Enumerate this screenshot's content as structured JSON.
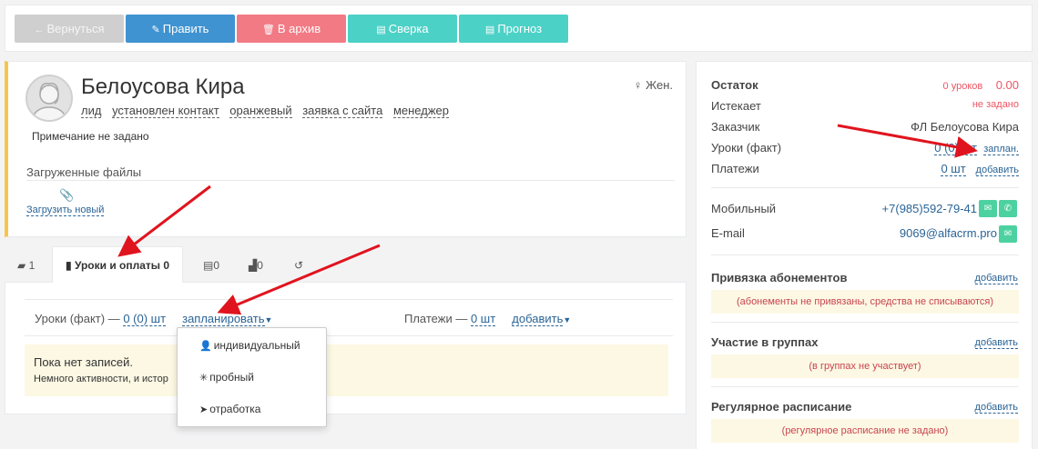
{
  "toolbar": {
    "back": "Вернуться",
    "edit": "Править",
    "archive": "В архив",
    "reconcile": "Сверка",
    "forecast": "Прогноз"
  },
  "profile": {
    "name": "Белоусова Кира",
    "gender": "Жен.",
    "tags": [
      "лид",
      "установлен контакт",
      "оранжевый",
      "заявка с сайта",
      "менеджер"
    ],
    "note": "Примечание не задано",
    "files_title": "Загруженные файлы",
    "upload": "Загрузить новый"
  },
  "tabs": [
    {
      "label": "1",
      "icon": "comments-icon"
    },
    {
      "label": "Уроки и оплаты 0",
      "icon": "book-icon",
      "active": true
    },
    {
      "label": "0",
      "icon": "clipboard-icon"
    },
    {
      "label": "0",
      "icon": "chart-icon"
    },
    {
      "label": "",
      "icon": "history-icon"
    }
  ],
  "lessons": {
    "label": "Уроки (факт) —",
    "count": "0 (0) шт",
    "plan": "запланировать",
    "payments_label": "Платежи —",
    "payments_count": "0 шт",
    "add": "добавить",
    "empty_title": "Пока нет записей.",
    "empty_text": "Немного активности, и истор"
  },
  "dropdown": {
    "items": [
      "индивидуальный",
      "пробный",
      "отработка"
    ]
  },
  "right": {
    "balance_label": "Остаток",
    "balance_lessons": "0 уроков",
    "balance_amount": "0.00",
    "expires_label": "Истекает",
    "expires_value": "не задано",
    "customer_label": "Заказчик",
    "customer_value": "ФЛ Белоусова Кира",
    "lessons_label": "Уроки (факт)",
    "lessons_value": "0 (0) шт",
    "lessons_plan": "заплан.",
    "payments_label": "Платежи",
    "payments_value": "0 шт",
    "payments_add": "добавить",
    "mobile_label": "Мобильный",
    "mobile_value": "+7(985)592-79-41",
    "email_label": "E-mail",
    "email_value": "9069@alfacrm.pro",
    "subs_title": "Привязка абонементов",
    "subs_add": "добавить",
    "subs_note": "(абонементы не привязаны, средства не списываются)",
    "groups_title": "Участие в группах",
    "groups_add": "добавить",
    "groups_note": "(в группах не участвует)",
    "schedule_title": "Регулярное расписание",
    "schedule_add": "добавить",
    "schedule_note": "(регулярное расписание не задано)"
  },
  "colors": {
    "edit": "#3f93d1",
    "archive": "#f27a85",
    "teal": "#4cd1c6",
    "accent_border": "#f8c54c",
    "arrow": "#e0141e"
  }
}
